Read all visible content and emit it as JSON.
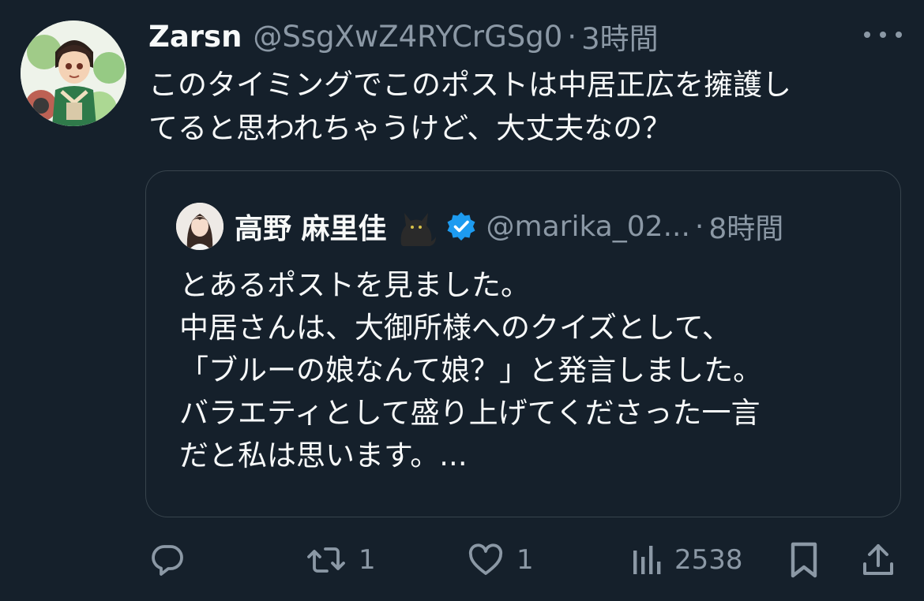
{
  "post": {
    "display_name": "Zarsn",
    "handle": "@SsgXwZ4RYCrGSg0",
    "separator": "·",
    "time": "3時間",
    "text": "このタイミングでこのポストは中居正広を擁護し\nてると思われちゃうけど、大丈夫なの？",
    "avatar_icon": "anime-character-avatar",
    "more_icon": "more-horizontal-icon"
  },
  "quote": {
    "display_name": "高野 麻里佳",
    "emoji": "🐈‍⬛",
    "verified_icon": "verified-badge-icon",
    "handle": "@marika_02...",
    "separator": "·",
    "time": "8時間",
    "text": "とあるポストを見ました。\n中居さんは、大御所様へのクイズとして、\n「ブルーの娘なんて娘？」と発言しました。\nバラエティとして盛り上げてくださった一言\nだと私は思います。..."
  },
  "actions": {
    "reply": {
      "icon": "reply-icon",
      "count": ""
    },
    "repost": {
      "icon": "repost-icon",
      "count": "1"
    },
    "like": {
      "icon": "heart-icon",
      "count": "1"
    },
    "views": {
      "icon": "views-chart-icon",
      "count": "2538"
    },
    "bookmark": {
      "icon": "bookmark-icon"
    },
    "share": {
      "icon": "share-icon"
    }
  },
  "colors": {
    "background": "#15202b",
    "text_primary": "#f7f9f9",
    "text_secondary": "#8b98a5",
    "border": "#38444d",
    "verified_blue": "#1d9bf0"
  }
}
